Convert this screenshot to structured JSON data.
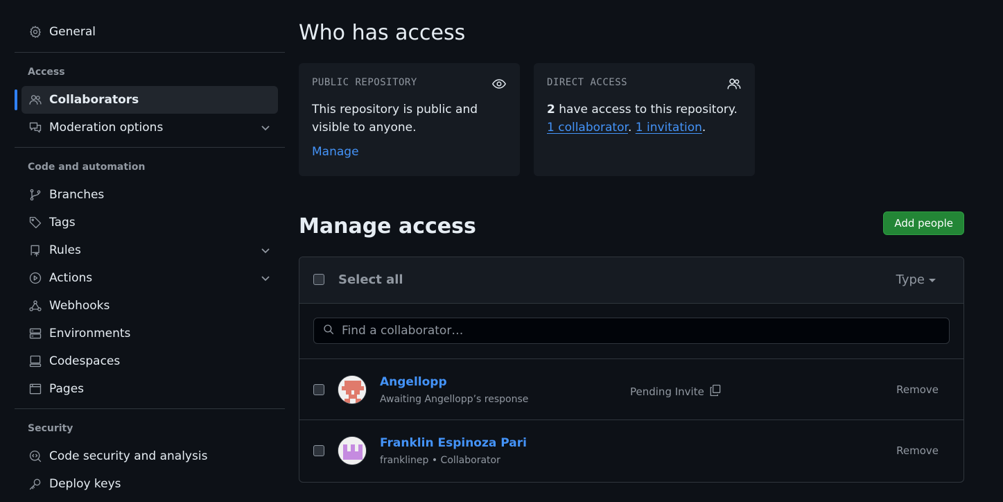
{
  "sidebar": {
    "general": {
      "label": "General",
      "icon": "gear-icon"
    },
    "sections": [
      {
        "heading": "Access",
        "items": [
          {
            "label": "Collaborators",
            "icon": "people-icon",
            "active": true
          },
          {
            "label": "Moderation options",
            "icon": "comment-discussion-icon",
            "expandable": true
          }
        ]
      },
      {
        "heading": "Code and automation",
        "items": [
          {
            "label": "Branches",
            "icon": "git-branch-icon"
          },
          {
            "label": "Tags",
            "icon": "tag-icon"
          },
          {
            "label": "Rules",
            "icon": "repo-push-icon",
            "expandable": true
          },
          {
            "label": "Actions",
            "icon": "play-icon",
            "expandable": true
          },
          {
            "label": "Webhooks",
            "icon": "webhook-icon"
          },
          {
            "label": "Environments",
            "icon": "server-icon"
          },
          {
            "label": "Codespaces",
            "icon": "codespaces-icon"
          },
          {
            "label": "Pages",
            "icon": "browser-icon"
          }
        ]
      },
      {
        "heading": "Security",
        "items": [
          {
            "label": "Code security and analysis",
            "icon": "codescan-icon"
          },
          {
            "label": "Deploy keys",
            "icon": "key-icon"
          }
        ]
      }
    ]
  },
  "main": {
    "who_title": "Who has access",
    "public_card": {
      "title": "PUBLIC REPOSITORY",
      "body": "This repository is public and visible to anyone.",
      "link": "Manage",
      "icon": "eye-icon"
    },
    "direct_card": {
      "title": "DIRECT ACCESS",
      "count": "2",
      "text": " have access to this repository. ",
      "collab_link": "1 collaborator",
      "sep": ". ",
      "invite_link": "1 invitation",
      "end": ".",
      "icon": "people-icon"
    },
    "manage_title": "Manage access",
    "add_button": "Add people",
    "table": {
      "select_all": "Select all",
      "type_label": "Type",
      "search_placeholder": "Find a collaborator…",
      "rows": [
        {
          "name": "Angellopp",
          "sub": "Awaiting Angellopp’s response",
          "status": "Pending Invite",
          "action": "Remove",
          "avatar_color": "#e07a6b"
        },
        {
          "name": "Franklin Espinoza Pari",
          "sub": "franklinep • Collaborator",
          "status": "",
          "action": "Remove",
          "avatar_color": "#c58be0"
        }
      ]
    }
  },
  "colors": {
    "background": "#0d1117",
    "card": "#161b22",
    "link": "#4493f8",
    "button_green": "#238636",
    "active_bar": "#2f81f7"
  }
}
